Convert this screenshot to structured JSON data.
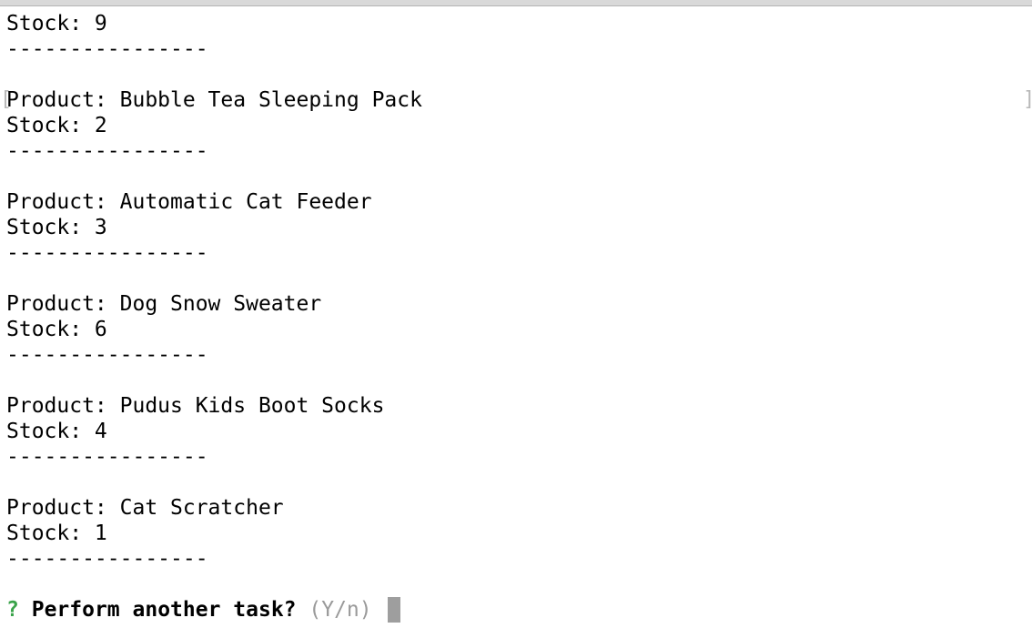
{
  "terminal": {
    "first_stock": "Stock: 9",
    "separator": "----------------",
    "products": [
      {
        "product": "Product: Bubble Tea Sleeping Pack",
        "stock": "Stock: 2"
      },
      {
        "product": "Product: Automatic Cat Feeder",
        "stock": "Stock: 3"
      },
      {
        "product": "Product: Dog Snow Sweater",
        "stock": "Stock: 6"
      },
      {
        "product": "Product: Pudus Kids Boot Socks",
        "stock": "Stock: 4"
      },
      {
        "product": "Product: Cat Scratcher",
        "stock": "Stock: 1"
      }
    ],
    "prompt": {
      "mark": "?",
      "question": "Perform another task?",
      "hint": "(Y/n)"
    },
    "selection_brackets": {
      "left": "[",
      "right": "]"
    }
  },
  "colors": {
    "prompt_mark": "#3aa34a",
    "hint": "#9a9a9a",
    "cursor": "#9e9e9e"
  }
}
